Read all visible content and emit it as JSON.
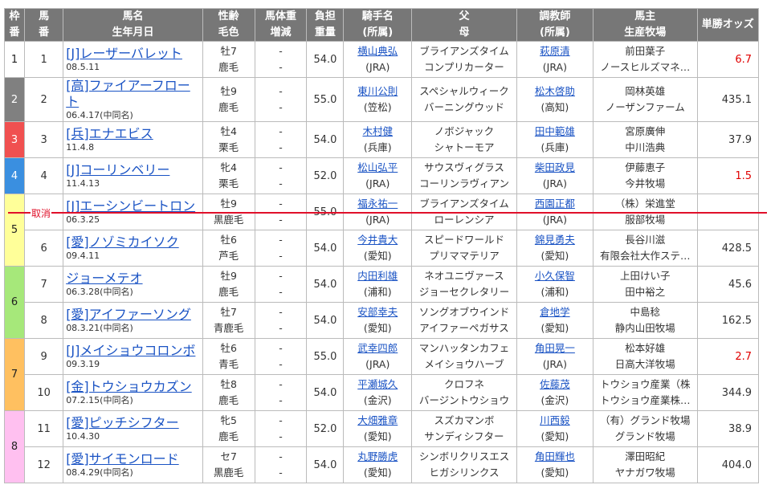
{
  "headers": {
    "frame": [
      "枠",
      "番"
    ],
    "num": [
      "馬",
      "番"
    ],
    "horse": [
      "馬名",
      "生年月日"
    ],
    "sexage": [
      "性齢",
      "毛色"
    ],
    "weightdiff": [
      "馬体重",
      "増減"
    ],
    "carry": [
      "負担",
      "重量"
    ],
    "jockey": [
      "騎手名",
      "(所属)"
    ],
    "sire": [
      "父",
      "母"
    ],
    "trainer": [
      "調教師",
      "(所属)"
    ],
    "owner": [
      "馬主",
      "生産牧場"
    ],
    "odds": "単勝オッズ"
  },
  "frame_colors": {
    "1": "#ffffff",
    "2": "#808080",
    "3": "#f05050",
    "4": "#3a8fe0",
    "5": "#ffff99",
    "6": "#a6e87a",
    "7": "#ffc060",
    "8": "#ffc0f0"
  },
  "cancel_label": "取消",
  "rows": [
    {
      "frame": "1",
      "num": "1",
      "name": "[J]レーザーバレット",
      "born": "08.5.11",
      "sexage": "牡7",
      "coat": "鹿毛",
      "wt": "-",
      "wtd": "-",
      "carry": "54.0",
      "jockey": "横山典弘",
      "jaff": "(JRA)",
      "sire": "ブライアンズタイム",
      "dam": "コンプリカーター",
      "trainer": "萩原清",
      "taff": "(JRA)",
      "owner": "前田葉子",
      "farm": "ノースヒルズマネ…",
      "odds": "6.7",
      "odds_red": true
    },
    {
      "frame": "2",
      "num": "2",
      "name": "[高]ファイアーフロート",
      "born": "06.4.17(中同名)",
      "sexage": "牡9",
      "coat": "鹿毛",
      "wt": "-",
      "wtd": "-",
      "carry": "55.0",
      "jockey": "東川公則",
      "jaff": "(笠松)",
      "sire": "スペシャルウィーク",
      "dam": "バーニングウッド",
      "trainer": "松木啓助",
      "taff": "(高知)",
      "owner": "岡林英雄",
      "farm": "ノーザンファーム",
      "odds": "435.1",
      "odds_red": false
    },
    {
      "frame": "3",
      "num": "3",
      "name": "[兵]エナエビス",
      "born": "11.4.8",
      "sexage": "牡4",
      "coat": "栗毛",
      "wt": "-",
      "wtd": "-",
      "carry": "54.0",
      "jockey": "木村健",
      "jaff": "(兵庫)",
      "sire": "ノボジャック",
      "dam": "シャトーモア",
      "trainer": "田中範雄",
      "taff": "(兵庫)",
      "owner": "宮原廣伸",
      "farm": "中川浩典",
      "odds": "37.9",
      "odds_red": false
    },
    {
      "frame": "4",
      "num": "4",
      "name": "[J]コーリンベリー",
      "born": "11.4.13",
      "sexage": "牝4",
      "coat": "栗毛",
      "wt": "-",
      "wtd": "-",
      "carry": "52.0",
      "jockey": "松山弘平",
      "jaff": "(JRA)",
      "sire": "サウスヴィグラス",
      "dam": "コーリンラヴィアン",
      "trainer": "柴田政見",
      "taff": "(JRA)",
      "owner": "伊藤恵子",
      "farm": "今井牧場",
      "odds": "1.5",
      "odds_red": true
    },
    {
      "frame": "5",
      "num": "",
      "name": "[J]エーシンビートロン",
      "born": "06.3.25",
      "sexage": "牡9",
      "coat": "黒鹿毛",
      "wt": "-",
      "wtd": "-",
      "carry": "55.0",
      "jockey": "福永祐一",
      "jaff": "(JRA)",
      "sire": "ブライアンズタイム",
      "dam": "ローレンシア",
      "trainer": "西園正都",
      "taff": "(JRA)",
      "owner": "（株）栄進堂",
      "farm": "服部牧場",
      "odds": "",
      "odds_red": false,
      "cancelled": true
    },
    {
      "frame": "5",
      "num": "6",
      "name": "[愛]ノゾミカイソク",
      "born": "09.4.11",
      "sexage": "牡6",
      "coat": "芦毛",
      "wt": "-",
      "wtd": "-",
      "carry": "54.0",
      "jockey": "今井貴大",
      "jaff": "(愛知)",
      "sire": "スピードワールド",
      "dam": "プリママテリア",
      "trainer": "錦見勇夫",
      "taff": "(愛知)",
      "owner": "長谷川滋",
      "farm": "有限会社大作ステ…",
      "odds": "428.5",
      "odds_red": false
    },
    {
      "frame": "6",
      "num": "7",
      "name": "ジョーメテオ",
      "born": "06.3.28(中同名)",
      "sexage": "牡9",
      "coat": "鹿毛",
      "wt": "-",
      "wtd": "-",
      "carry": "54.0",
      "jockey": "内田利雄",
      "jaff": "(浦和)",
      "sire": "ネオユニヴァース",
      "dam": "ジョーセクレタリー",
      "trainer": "小久保智",
      "taff": "(浦和)",
      "owner": "上田けい子",
      "farm": "田中裕之",
      "odds": "45.6",
      "odds_red": false
    },
    {
      "frame": "6",
      "num": "8",
      "name": "[愛]アイファーソング",
      "born": "08.3.21(中同名)",
      "sexage": "牡7",
      "coat": "青鹿毛",
      "wt": "-",
      "wtd": "-",
      "carry": "54.0",
      "jockey": "安部幸夫",
      "jaff": "(愛知)",
      "sire": "ソングオブウインド",
      "dam": "アイファーペガサス",
      "trainer": "倉地学",
      "taff": "(愛知)",
      "owner": "中島稔",
      "farm": "静内山田牧場",
      "odds": "162.5",
      "odds_red": false
    },
    {
      "frame": "7",
      "num": "9",
      "name": "[J]メイショウコロンボ",
      "born": "09.3.19",
      "sexage": "牡6",
      "coat": "青毛",
      "wt": "-",
      "wtd": "-",
      "carry": "55.0",
      "jockey": "武幸四郎",
      "jaff": "(JRA)",
      "sire": "マンハッタンカフェ",
      "dam": "メイショウハーブ",
      "trainer": "角田晃一",
      "taff": "(JRA)",
      "owner": "松本好雄",
      "farm": "日高大洋牧場",
      "odds": "2.7",
      "odds_red": true
    },
    {
      "frame": "7",
      "num": "10",
      "name": "[金]トウショウカズン",
      "born": "07.2.15(中同名)",
      "sexage": "牡8",
      "coat": "鹿毛",
      "wt": "-",
      "wtd": "-",
      "carry": "54.0",
      "jockey": "平瀬城久",
      "jaff": "(金沢)",
      "sire": "クロフネ",
      "dam": "バージントウショウ",
      "trainer": "佐藤茂",
      "taff": "(金沢)",
      "owner": "トウショウ産業（株",
      "farm": "トウショウ産業株…",
      "odds": "344.9",
      "odds_red": false
    },
    {
      "frame": "8",
      "num": "11",
      "name": "[愛]ピッチシフター",
      "born": "10.4.30",
      "sexage": "牝5",
      "coat": "鹿毛",
      "wt": "-",
      "wtd": "-",
      "carry": "52.0",
      "jockey": "大畑雅章",
      "jaff": "(愛知)",
      "sire": "スズカマンボ",
      "dam": "サンディシフター",
      "trainer": "川西毅",
      "taff": "(愛知)",
      "owner": "（有）グランド牧場",
      "farm": "グランド牧場",
      "odds": "38.9",
      "odds_red": false
    },
    {
      "frame": "8",
      "num": "12",
      "name": "[愛]サイモンロード",
      "born": "08.4.29(中同名)",
      "sexage": "セ7",
      "coat": "黒鹿毛",
      "wt": "-",
      "wtd": "-",
      "carry": "54.0",
      "jockey": "丸野勝虎",
      "jaff": "(愛知)",
      "sire": "シンボリクリスエス",
      "dam": "ヒガシリンクス",
      "trainer": "角田輝也",
      "taff": "(愛知)",
      "owner": "澤田昭紀",
      "farm": "ヤナガワ牧場",
      "odds": "404.0",
      "odds_red": false
    }
  ]
}
